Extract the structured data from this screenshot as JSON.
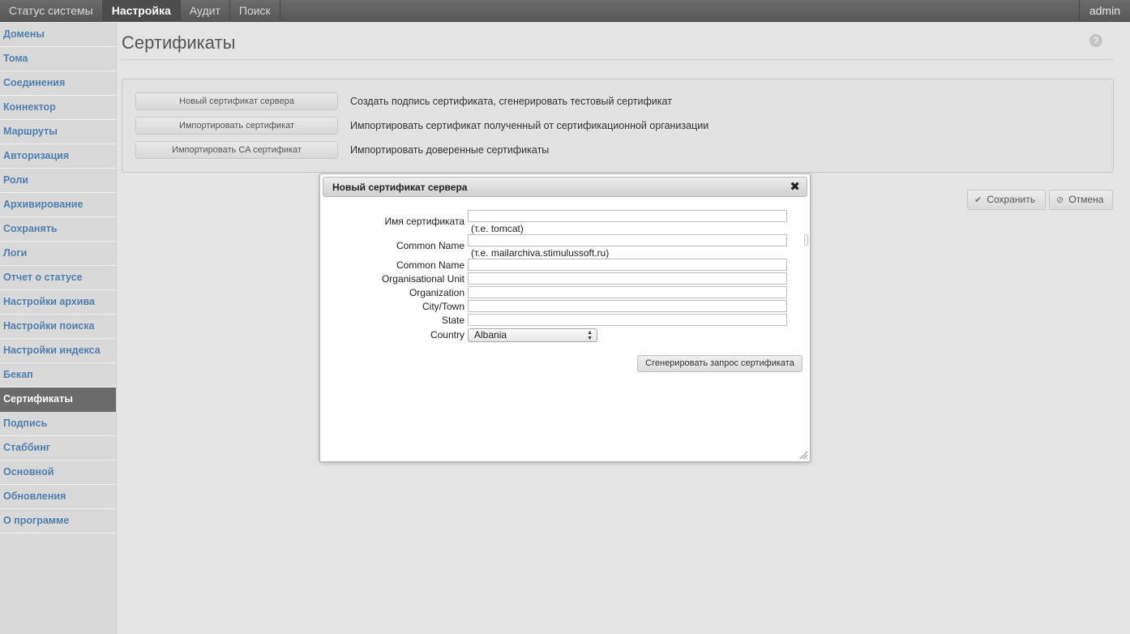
{
  "topnav": {
    "items": [
      {
        "label": "Статус системы"
      },
      {
        "label": "Настройка"
      },
      {
        "label": "Аудит"
      },
      {
        "label": "Поиск"
      }
    ],
    "active_index": 1,
    "user": "admin"
  },
  "sidebar": {
    "items": [
      {
        "label": "Домены"
      },
      {
        "label": "Тома"
      },
      {
        "label": "Соединения"
      },
      {
        "label": "Коннектор"
      },
      {
        "label": "Маршруты"
      },
      {
        "label": "Авторизация"
      },
      {
        "label": "Роли"
      },
      {
        "label": "Архивирование"
      },
      {
        "label": "Сохранять"
      },
      {
        "label": "Логи"
      },
      {
        "label": "Отчет о статусе"
      },
      {
        "label": "Настройки архива"
      },
      {
        "label": "Настройки поиска"
      },
      {
        "label": "Настройки индекса"
      },
      {
        "label": "Бекап"
      },
      {
        "label": "Сертификаты"
      },
      {
        "label": "Подпись"
      },
      {
        "label": "Стаббинг"
      },
      {
        "label": "Основной"
      },
      {
        "label": "Обновления"
      },
      {
        "label": "О программе"
      }
    ],
    "active_index": 15
  },
  "page": {
    "title": "Сертификаты",
    "help_icon": "question-icon"
  },
  "actions": [
    {
      "button": "Новый сертификат сервера",
      "description": "Создать подпись сертификата, сгенерировать тестовый сертификат"
    },
    {
      "button": "Импортировать сертификат",
      "description": "Импортировать сертификат полученный от сертификационной организации"
    },
    {
      "button": "Импортировать CA сертификат",
      "description": "Импортировать доверенные сертификаты"
    }
  ],
  "toolbar": {
    "save_label": "Сохранить",
    "save_icon": "✔",
    "cancel_label": "Отмена",
    "cancel_icon": "⊘"
  },
  "dialog": {
    "title": "Новый сертификат сервера",
    "close_icon": "✖",
    "fields": {
      "cert_name_label": "Имя сертификата",
      "cert_name_value": "",
      "cert_name_hint": "(т.е. tomcat)",
      "cn1_label": "Common Name",
      "cn1_value": "",
      "cn1_hint": "(т.е. mailarchiva.stimulussoft.ru)",
      "cn2_label": "Common Name",
      "cn2_value": "",
      "ou_label": "Organisational Unit",
      "ou_value": "",
      "org_label": "Organization",
      "org_value": "",
      "city_label": "City/Town",
      "city_value": "",
      "state_label": "State",
      "state_value": "",
      "country_label": "Country",
      "country_value": "Albania"
    },
    "generate_button": "Сгенерировать запрос сертификата"
  }
}
